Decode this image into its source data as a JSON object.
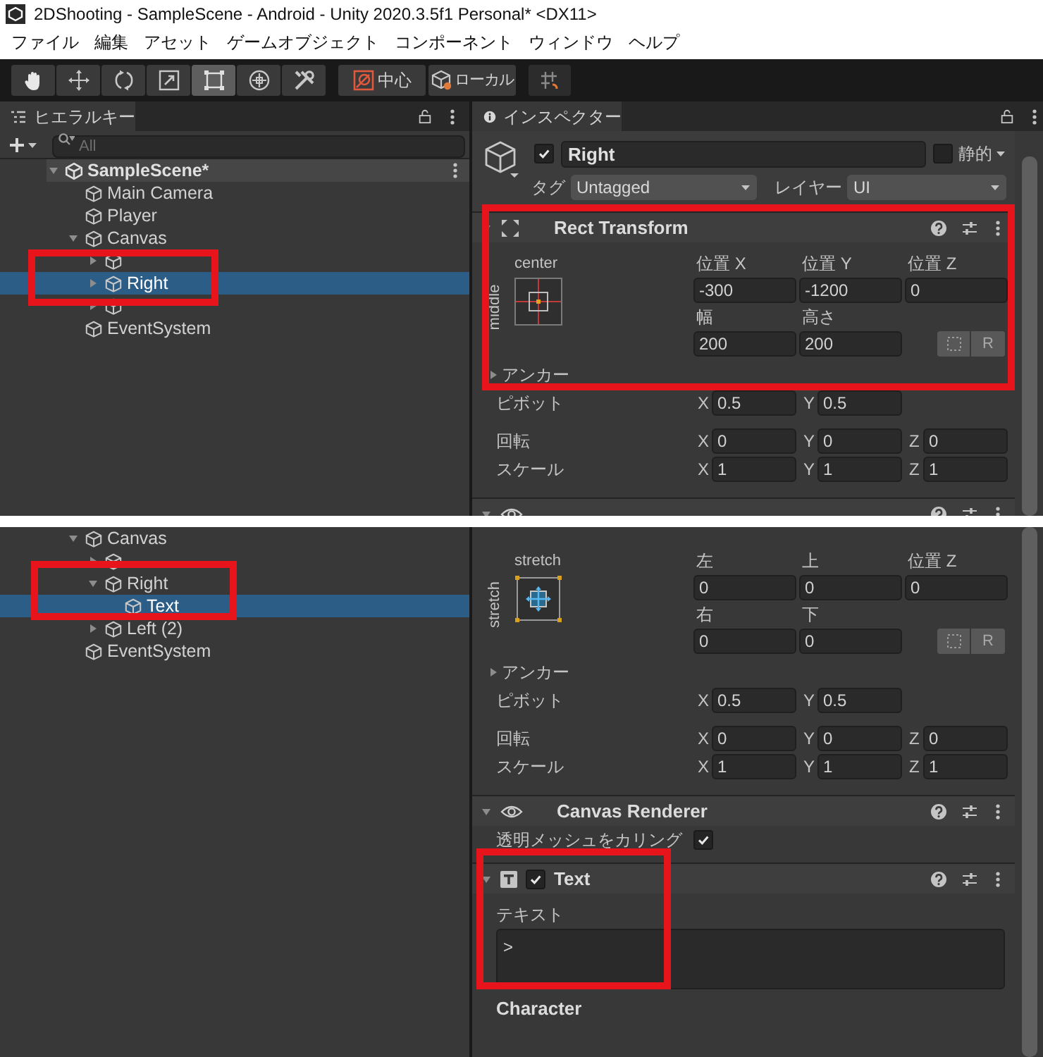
{
  "window": {
    "title": "2DShooting - SampleScene - Android - Unity 2020.3.5f1 Personal* <DX11>"
  },
  "menu": [
    "ファイル",
    "編集",
    "アセット",
    "ゲームオブジェクト",
    "コンポーネント",
    "ウィンドウ",
    "ヘルプ"
  ],
  "toolbar": {
    "tools": [
      {
        "kind": "hand",
        "selected": false
      },
      {
        "kind": "move",
        "selected": false
      },
      {
        "kind": "rotate",
        "selected": false
      },
      {
        "kind": "scale",
        "selected": false
      },
      {
        "kind": "rect",
        "selected": true
      },
      {
        "kind": "transform",
        "selected": false
      },
      {
        "kind": "custom",
        "selected": false
      }
    ],
    "pivot_mode": "中心",
    "pivot_space": "ローカル"
  },
  "captures": [
    {
      "hierarchy": {
        "tab": "ヒエラルキー",
        "search_placeholder": "All",
        "scene": {
          "name": "SampleScene*",
          "expanded": true
        },
        "items": [
          {
            "name": "Main Camera",
            "selected": false
          },
          {
            "name": "Player",
            "selected": false
          },
          {
            "name": "Canvas",
            "selected": false,
            "expanded": true,
            "children": [
              {
                "selected": false,
                "expanded": false
              },
              {
                "name": "Right",
                "selected": true,
                "expanded": false
              },
              {
                "selected": false,
                "expanded": false
              }
            ]
          },
          {
            "name": "EventSystem",
            "selected": false
          }
        ]
      },
      "inspector": {
        "tab": "インスペクター",
        "object": {
          "active": true,
          "name": "Right",
          "static": false,
          "static_label": "静的",
          "tag_label": "タグ",
          "tag": "Untagged",
          "layer_label": "レイヤー",
          "layer": "UI"
        },
        "components": [
          {
            "kind": "rect_transform",
            "title": "Rect Transform",
            "anchor": {
              "kind": "center",
              "h_label": "center",
              "v_label": "middle"
            },
            "fields": [
              {
                "label": "位置 X",
                "value": "-300"
              },
              {
                "label": "位置 Y",
                "value": "-1200"
              },
              {
                "label": "位置 Z",
                "value": "0"
              },
              {
                "label": "幅",
                "value": "200"
              },
              {
                "label": "高さ",
                "value": "200"
              }
            ],
            "raw_button": "R",
            "anchors_label": "アンカー",
            "anchors_expanded": false,
            "vectors": [
              {
                "label": "ピボット",
                "axes": [
                  {
                    "axis": "X",
                    "value": "0.5"
                  },
                  {
                    "axis": "Y",
                    "value": "0.5"
                  }
                ]
              },
              {
                "label": "回転",
                "axes": [
                  {
                    "axis": "X",
                    "value": "0"
                  },
                  {
                    "axis": "Y",
                    "value": "0"
                  },
                  {
                    "axis": "Z",
                    "value": "0"
                  }
                ]
              },
              {
                "label": "スケール",
                "axes": [
                  {
                    "axis": "X",
                    "value": "1"
                  },
                  {
                    "axis": "Y",
                    "value": "1"
                  },
                  {
                    "axis": "Z",
                    "value": "1"
                  }
                ]
              }
            ]
          },
          {
            "kind": "canvas_renderer"
          }
        ]
      }
    },
    {
      "hierarchy": {
        "items": [
          {
            "name": "Canvas",
            "selected": false,
            "expanded": true,
            "children": [
              {
                "selected": false,
                "expanded": false
              },
              {
                "name": "Right",
                "selected": false,
                "expanded": true,
                "children": [
                  {
                    "name": "Text",
                    "selected": true
                  }
                ]
              },
              {
                "name": "Left (2)",
                "selected": false,
                "expanded": false
              }
            ]
          },
          {
            "name": "EventSystem",
            "selected": false
          }
        ]
      },
      "inspector": {
        "components": [
          {
            "kind": "rect_transform",
            "anchor": {
              "kind": "stretch",
              "h_label": "stretch",
              "v_label": "stretch"
            },
            "fields": [
              {
                "label": "左",
                "value": "0"
              },
              {
                "label": "上",
                "value": "0"
              },
              {
                "label": "位置 Z",
                "value": "0"
              },
              {
                "label": "右",
                "value": "0"
              },
              {
                "label": "下",
                "value": "0"
              }
            ],
            "raw_button": "R",
            "anchors_label": "アンカー",
            "anchors_expanded": false,
            "vectors": [
              {
                "label": "ピボット",
                "axes": [
                  {
                    "axis": "X",
                    "value": "0.5"
                  },
                  {
                    "axis": "Y",
                    "value": "0.5"
                  }
                ]
              },
              {
                "label": "回転",
                "axes": [
                  {
                    "axis": "X",
                    "value": "0"
                  },
                  {
                    "axis": "Y",
                    "value": "0"
                  },
                  {
                    "axis": "Z",
                    "value": "0"
                  }
                ]
              },
              {
                "label": "スケール",
                "axes": [
                  {
                    "axis": "X",
                    "value": "1"
                  },
                  {
                    "axis": "Y",
                    "value": "1"
                  },
                  {
                    "axis": "Z",
                    "value": "1"
                  }
                ]
              }
            ]
          },
          {
            "kind": "canvas_renderer",
            "title": "Canvas Renderer",
            "properties": [
              {
                "kind": "toggle",
                "label": "透明メッシュをカリング",
                "checked": true
              }
            ]
          },
          {
            "kind": "text",
            "title": "Text",
            "enabled": true,
            "text_label": "テキスト",
            "text_value": ">",
            "section": "Character"
          }
        ]
      }
    }
  ]
}
